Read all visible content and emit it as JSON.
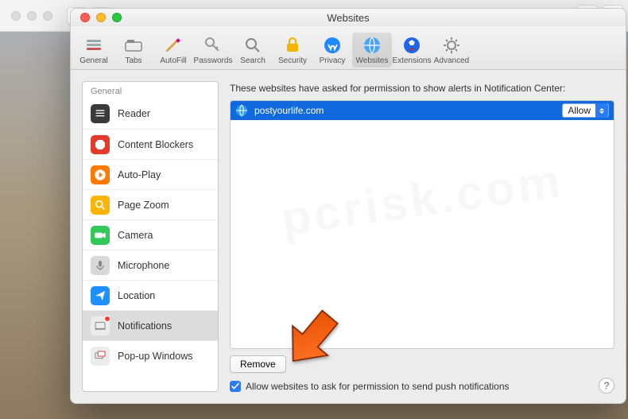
{
  "window": {
    "title": "Websites"
  },
  "toolbar": {
    "items": [
      {
        "label": "General",
        "icon": "general-icon"
      },
      {
        "label": "Tabs",
        "icon": "tabs-icon"
      },
      {
        "label": "AutoFill",
        "icon": "autofill-icon"
      },
      {
        "label": "Passwords",
        "icon": "passwords-icon"
      },
      {
        "label": "Search",
        "icon": "search-icon"
      },
      {
        "label": "Security",
        "icon": "security-icon"
      },
      {
        "label": "Privacy",
        "icon": "privacy-icon"
      },
      {
        "label": "Websites",
        "icon": "websites-icon",
        "selected": true
      },
      {
        "label": "Extensions",
        "icon": "extensions-icon"
      },
      {
        "label": "Advanced",
        "icon": "advanced-icon"
      }
    ]
  },
  "sidebar": {
    "header": "General",
    "items": [
      {
        "label": "Reader",
        "icon": "reader-icon",
        "color": "#3a3a3a"
      },
      {
        "label": "Content Blockers",
        "icon": "stop-icon",
        "color": "#e23b2e"
      },
      {
        "label": "Auto-Play",
        "icon": "play-icon",
        "color": "#ff7a00"
      },
      {
        "label": "Page Zoom",
        "icon": "zoom-icon",
        "color": "#ffb400"
      },
      {
        "label": "Camera",
        "icon": "camera-icon",
        "color": "#34c759"
      },
      {
        "label": "Microphone",
        "icon": "mic-icon",
        "color": "#d8d8d8"
      },
      {
        "label": "Location",
        "icon": "location-icon",
        "color": "#1e90ff"
      },
      {
        "label": "Notifications",
        "icon": "notify-icon",
        "color": "#ececec",
        "selected": true,
        "badge": true
      },
      {
        "label": "Pop-up Windows",
        "icon": "popup-icon",
        "color": "#ececec"
      }
    ]
  },
  "panel": {
    "description": "These websites have asked for permission to show alerts in Notification Center:",
    "site": {
      "name": "postyourlife.com",
      "permission": "Allow"
    },
    "remove_label": "Remove",
    "checkbox_label": "Allow websites to ask for permission to send push notifications",
    "checkbox_checked": true
  }
}
